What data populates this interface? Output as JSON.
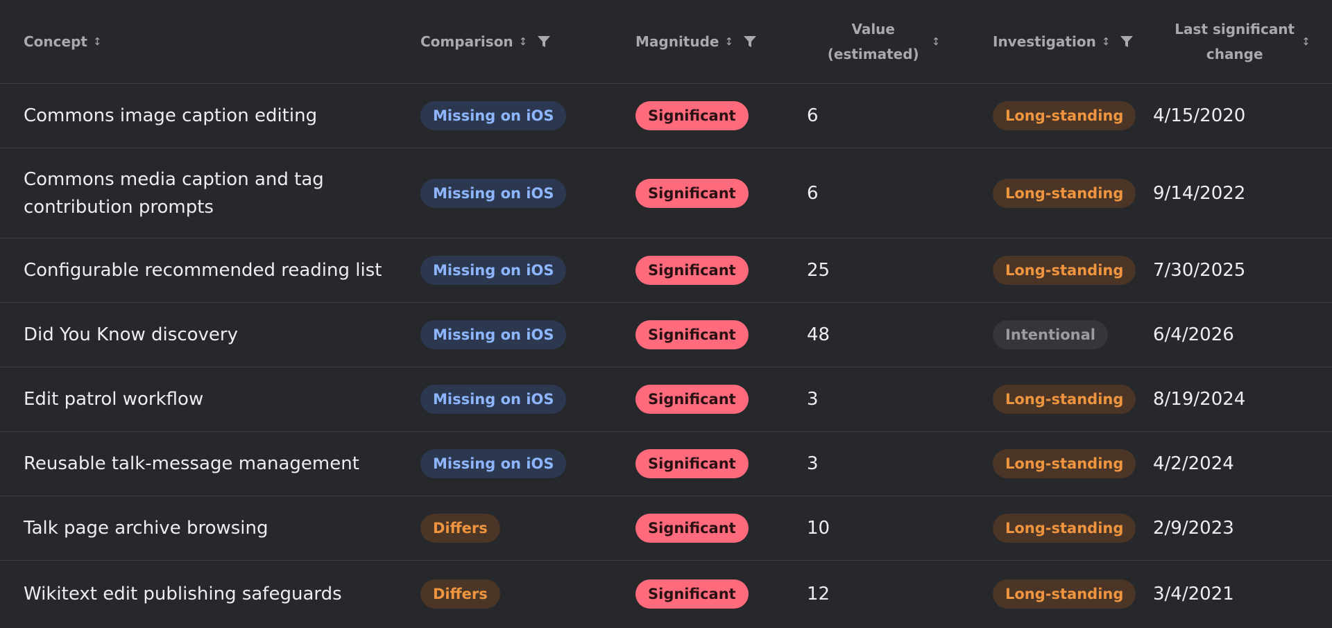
{
  "headers": {
    "concept": "Concept",
    "comparison": "Comparison",
    "magnitude": "Magnitude",
    "value_line1": "Value",
    "value_line2": "(estimated)",
    "investigation": "Investigation",
    "last_line1": "Last significant",
    "last_line2": "change",
    "sort_glyph": "↕"
  },
  "colors": {
    "background": "#27282c",
    "comparison_blue": "#8eb6ff",
    "comparison_orange": "#f0953f",
    "magnitude_red": "#ff6b7d",
    "investigation_gray": "#9a9ca2"
  },
  "icons": {
    "sort": "sort-icon",
    "filter": "filter-icon"
  },
  "rows": [
    {
      "concept": "Commons image caption editing",
      "comparison": "Missing on iOS",
      "magnitude": "Significant",
      "value": "6",
      "investigation": "Long-standing",
      "last_change": "4/15/2020"
    },
    {
      "concept": "Commons media caption and tag contribution prompts",
      "comparison": "Missing on iOS",
      "magnitude": "Significant",
      "value": "6",
      "investigation": "Long-standing",
      "last_change": "9/14/2022"
    },
    {
      "concept": "Configurable recommended reading list",
      "comparison": "Missing on iOS",
      "magnitude": "Significant",
      "value": "25",
      "investigation": "Long-standing",
      "last_change": "7/30/2025"
    },
    {
      "concept": "Did You Know discovery",
      "comparison": "Missing on iOS",
      "magnitude": "Significant",
      "value": "48",
      "investigation": "Intentional",
      "last_change": "6/4/2026"
    },
    {
      "concept": "Edit patrol workflow",
      "comparison": "Missing on iOS",
      "magnitude": "Significant",
      "value": "3",
      "investigation": "Long-standing",
      "last_change": "8/19/2024"
    },
    {
      "concept": "Reusable talk-message management",
      "comparison": "Missing on iOS",
      "magnitude": "Significant",
      "value": "3",
      "investigation": "Long-standing",
      "last_change": "4/2/2024"
    },
    {
      "concept": "Talk page archive browsing",
      "comparison": "Differs",
      "magnitude": "Significant",
      "value": "10",
      "investigation": "Long-standing",
      "last_change": "2/9/2023"
    },
    {
      "concept": "Wikitext edit publishing safeguards",
      "comparison": "Differs",
      "magnitude": "Significant",
      "value": "12",
      "investigation": "Long-standing",
      "last_change": "3/4/2021"
    }
  ]
}
